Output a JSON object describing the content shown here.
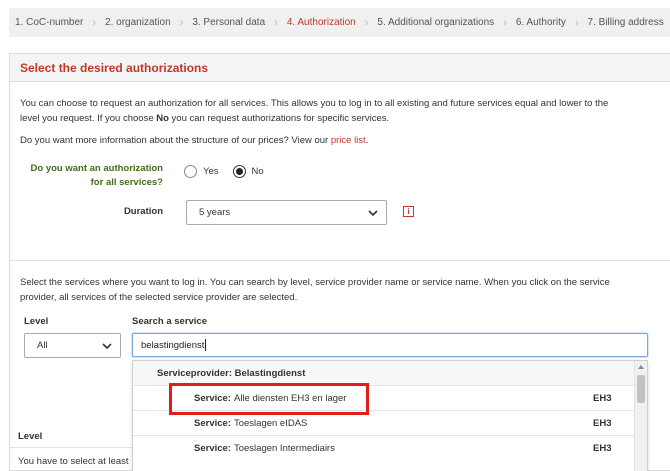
{
  "steps": [
    {
      "label": "1. CoC-number",
      "active": false
    },
    {
      "label": "2. organization",
      "active": false
    },
    {
      "label": "3. Personal data",
      "active": false
    },
    {
      "label": "4. Authorization",
      "active": true
    },
    {
      "label": "5. Additional organizations",
      "active": false
    },
    {
      "label": "6. Authority",
      "active": false
    },
    {
      "label": "7. Billing address",
      "active": false
    }
  ],
  "panel": {
    "title": "Select the desired authorizations",
    "intro_line1": "You can choose to request an authorization for all services. This allows you to log in to all existing and future services equal and lower to the",
    "intro_line2_a": "level you request. If you choose ",
    "intro_line2_bold": "No",
    "intro_line2_b": " you can request authorizations for specific services.",
    "prices_text": "Do you want more information about the structure of our prices? View our ",
    "prices_link": "price list",
    "prices_end": "."
  },
  "all_services": {
    "question_line1": "Do you want an authorization",
    "question_line2": "for all services?",
    "options": [
      "Yes",
      "No"
    ],
    "selected": "No"
  },
  "duration": {
    "label": "Duration",
    "value": "5 years",
    "info_icon": "i"
  },
  "services": {
    "intro_line1": "Select the services where you want to log in. You can search by level, service provider name or service name. When you click on the service",
    "intro_line2": "provider, all services of the selected service provider are selected.",
    "level_label": "Level",
    "level_value": "All",
    "search_label": "Search a service",
    "search_value": "belastingdienst"
  },
  "dropdown": {
    "group_label": "Serviceprovider: Belastingdienst",
    "items": [
      {
        "prefix": "Service:",
        "name": "Alle diensten EH3 en lager",
        "level": "EH3",
        "highlighted": true
      },
      {
        "prefix": "Service:",
        "name": "Toeslagen eIDAS",
        "level": "EH3",
        "highlighted": false
      },
      {
        "prefix": "Service:",
        "name": "Toeslagen Intermediairs",
        "level": "EH3",
        "highlighted": false
      }
    ]
  },
  "behind": {
    "level_heading": "Level",
    "note": "You have to select at least"
  },
  "colors": {
    "accent": "#c0392b",
    "question_green": "#3f6e1a",
    "highlight_red": "#e31d1d"
  }
}
